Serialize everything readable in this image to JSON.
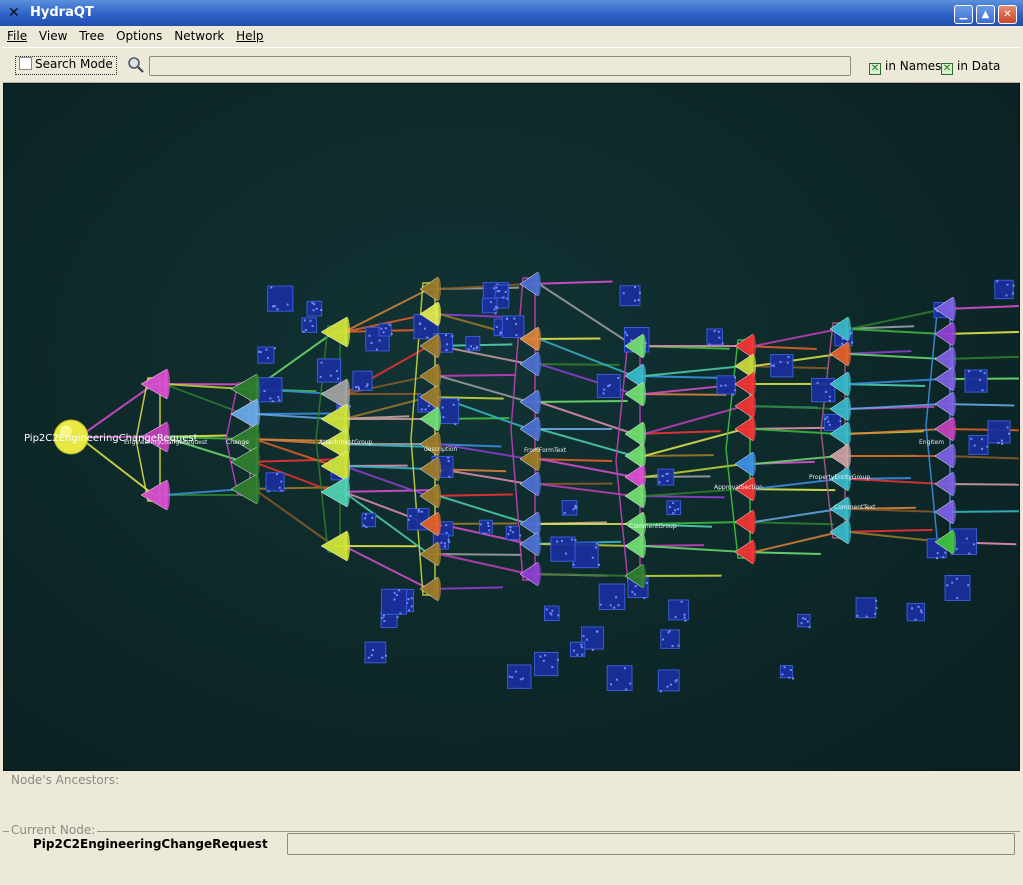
{
  "window": {
    "title": "HydraQT"
  },
  "menu": [
    "File",
    "View",
    "Tree",
    "Options",
    "Network",
    "Help"
  ],
  "search": {
    "mode_label": "Search Mode",
    "mode_checked": false,
    "query": "",
    "in_names_label": "in Names",
    "in_names_checked": true,
    "in_data_label": "in Data",
    "in_data_checked": true
  },
  "viz": {
    "root_label": "Pip2C2EngineeringChangeRequest",
    "node_labels": [
      "EngineeringChangeRequest",
      "Change",
      "AttachmentGroup",
      "description",
      "FromFormText",
      "CommentGroup",
      "ApprovalSection",
      "PropertyEntityGroup",
      "CommentText",
      "EngItem"
    ]
  },
  "panels": {
    "ancestors_label": "Node's Ancestors:",
    "current_label": "Current Node:",
    "current_value": "Pip2C2EngineeringChangeRequest",
    "current_extra": ""
  },
  "colors": {
    "canvas_bg": "#0d2728",
    "titlebar": "#2d62c8",
    "window_bg": "#ece9d8"
  }
}
